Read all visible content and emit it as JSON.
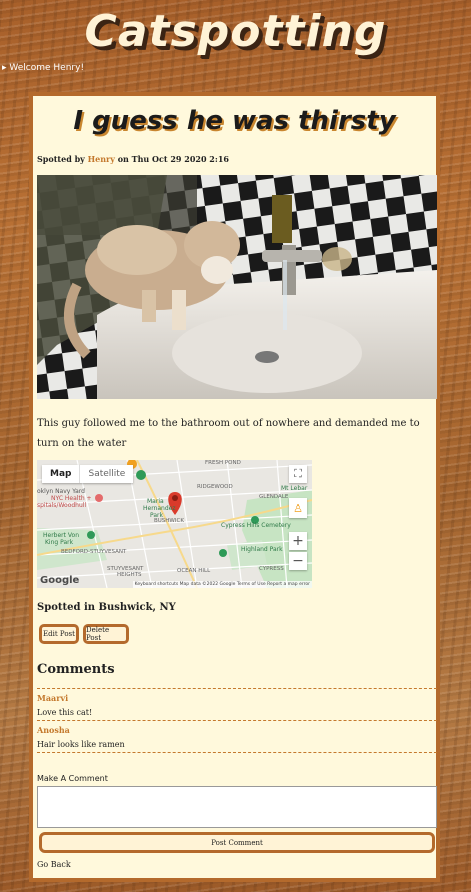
{
  "site": {
    "title": "Catspotting",
    "welcome": "Welcome Henry!"
  },
  "post": {
    "title": "I guess he was thirsty",
    "byline_prefix": "Spotted by ",
    "author": "Henry",
    "byline_suffix": " on Thu Oct 29 2020 2:16",
    "description": "This guy followed me to the bathroom out of nowhere and demanded me to turn on the water",
    "location": "Spotted in Bushwick, NY"
  },
  "map": {
    "tab_map": "Map",
    "tab_satellite": "Satellite",
    "logo": "Google",
    "footer": "Keyboard shortcuts   Map data ©2022 Google   Terms of Use   Report a map error",
    "labels": {
      "navy": "oklyn Navy Yard",
      "nyc_health": "NYC Health +",
      "woodhull": "spitals/Woodhull",
      "maria": "Maria",
      "hernandez": "Hernandez",
      "park": "Park",
      "bushwick": "BUSHWICK",
      "ridgewood": "RIDGEWOOD",
      "glendale": "GLENDALE",
      "mt_lebanon": "Mt Lebar",
      "cypress": "Cypress Hills Cemetery",
      "herbert": "Herbert Von",
      "king": "King Park",
      "bedford": "BEDFORD-STUYVESANT",
      "highland": "Highland Park",
      "stuyvesant": "STUYVESANT",
      "heights": "HEIGHTS",
      "ocean_hill": "OCEAN HILL",
      "cypress_hills": "CYPRESS",
      "fresh_pond": "FRESH POND"
    }
  },
  "buttons": {
    "edit": "Edit Post",
    "delete": "Delete Post"
  },
  "comments": {
    "heading": "Comments",
    "items": [
      {
        "author": "Maarvi",
        "text": "Love this cat!"
      },
      {
        "author": "Anosha",
        "text": "Hair looks like ramen"
      }
    ],
    "make_label": "Make A Comment",
    "post_button": "Post Comment",
    "go_back": "Go Back"
  }
}
